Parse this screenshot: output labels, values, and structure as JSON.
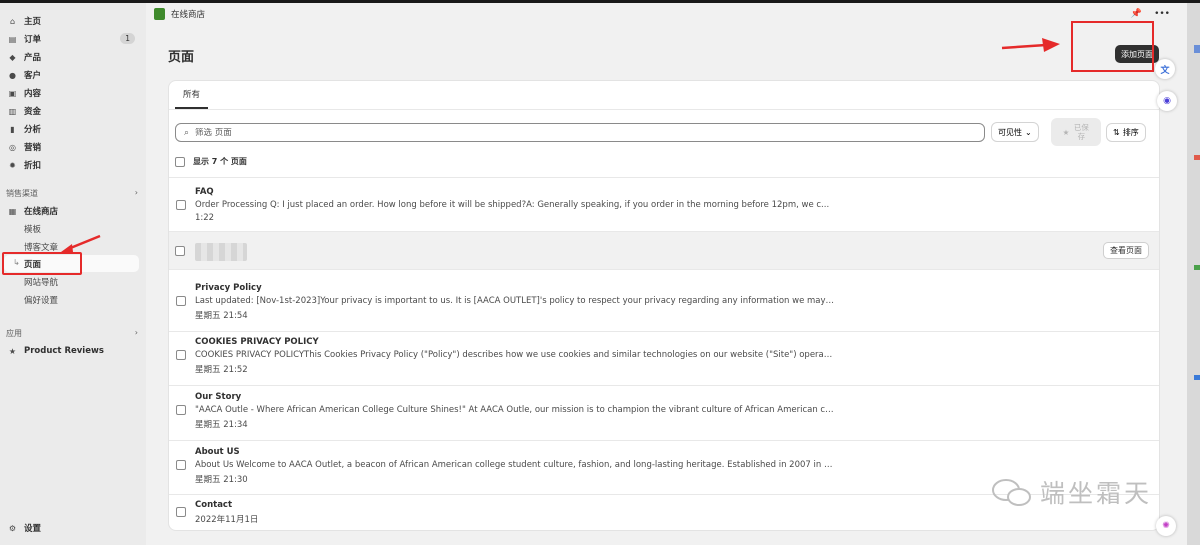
{
  "sidebar": {
    "main_items": [
      {
        "label": "主页",
        "icon": "home-icon"
      },
      {
        "label": "订单",
        "icon": "orders-icon",
        "badge": "1"
      },
      {
        "label": "产品",
        "icon": "tag-icon"
      },
      {
        "label": "客户",
        "icon": "person-icon"
      },
      {
        "label": "内容",
        "icon": "image-icon"
      },
      {
        "label": "资金",
        "icon": "bank-icon"
      },
      {
        "label": "分析",
        "icon": "chart-icon"
      },
      {
        "label": "营销",
        "icon": "target-icon"
      },
      {
        "label": "折扣",
        "icon": "discount-icon"
      }
    ],
    "sales_channels_title": "销售渠道",
    "online_store_label": "在线商店",
    "online_store_sub": [
      "模板",
      "博客文章",
      "页面",
      "网站导航",
      "偏好设置"
    ],
    "apps_title": "应用",
    "app_item_label": "Product Reviews",
    "settings_label": "设置"
  },
  "header": {
    "store_name": "在线商店"
  },
  "page": {
    "title": "页面",
    "add_button": "添加页面"
  },
  "toolbar": {
    "tab_all": "所有",
    "search_placeholder": "筛选 页面",
    "visibility_label": "可见性",
    "saved_label": "已保存",
    "sort_label": "排序",
    "count_label": "显示 7 个 页面"
  },
  "pages": [
    {
      "title": "FAQ",
      "excerpt": "Order Processing Q: I just placed an order. How long before it will be shipped?A: Generally speaking, if you order in the morning before 12pm, we c...",
      "date": "1:22"
    },
    {
      "title": "",
      "excerpt": "",
      "date": "",
      "view_button": "查看页面"
    },
    {
      "title": "Privacy Policy",
      "excerpt": "Last updated: [Nov-1st-2023]Your privacy is important to us. It is [AACA OUTLET]'s policy to respect your privacy regarding any information we may ...",
      "date": "星期五 21:54"
    },
    {
      "title": "COOKIES PRIVACY POLICY",
      "excerpt": "COOKIES PRIVACY POLICYThis Cookies Privacy Policy (\"Policy\") describes how we use cookies and similar technologies on our website (\"Site\") operated...",
      "date": "星期五 21:52"
    },
    {
      "title": "Our Story",
      "excerpt": "\"AACA Outle - Where African American College Culture Shines!\" At AACA Outle, our mission is to champion the vibrant culture of African American col...",
      "date": "星期五 21:34"
    },
    {
      "title": "About US",
      "excerpt": "About Us Welcome to AACA Outlet, a beacon of African American college student culture, fashion, and long-lasting heritage. Established in 2007 in t...",
      "date": "星期五 21:30"
    },
    {
      "title": "Contact",
      "excerpt": "",
      "date": "2022年11月1日"
    }
  ],
  "watermark": "端坐霜天",
  "colors": {
    "annotation_red": "#e52a2a",
    "primary_button": "#303030",
    "store_logo": "#3f8a2c"
  }
}
